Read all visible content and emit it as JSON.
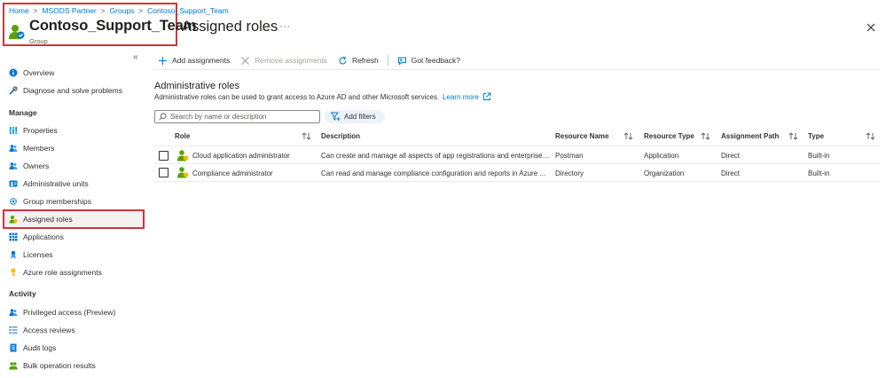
{
  "breadcrumb": [
    "Home",
    "MSODS Partner",
    "Groups",
    "Contoso_Support_Team"
  ],
  "header": {
    "group_name": "Contoso_Support_Team",
    "group_type": "Group",
    "page_title": "Assigned roles",
    "more_label": "···",
    "close_icon": "close-icon"
  },
  "sidebar": {
    "collapse_label": "«",
    "items": [
      {
        "label": "Overview",
        "icon": "info-icon",
        "color": "#0078d4"
      },
      {
        "label": "Diagnose and solve problems",
        "icon": "wrench-icon",
        "color": "#605e5c"
      }
    ],
    "manage_heading": "Manage",
    "manage_items": [
      {
        "label": "Properties",
        "icon": "properties-icon",
        "color": "#0078d4"
      },
      {
        "label": "Members",
        "icon": "members-icon",
        "color": "#0078d4"
      },
      {
        "label": "Owners",
        "icon": "owners-icon",
        "color": "#0078d4"
      },
      {
        "label": "Administrative units",
        "icon": "admin-units-icon",
        "color": "#0078d4"
      },
      {
        "label": "Group memberships",
        "icon": "gear-icon",
        "color": "#0078d4"
      },
      {
        "label": "Assigned roles",
        "icon": "assigned-roles-icon",
        "color": "#57a300",
        "selected": true
      },
      {
        "label": "Applications",
        "icon": "grid-icon",
        "color": "#0078d4"
      },
      {
        "label": "Licenses",
        "icon": "license-icon",
        "color": "#0078d4"
      },
      {
        "label": "Azure role assignments",
        "icon": "key-icon",
        "color": "#ffb900"
      }
    ],
    "activity_heading": "Activity",
    "activity_items": [
      {
        "label": "Privileged access (Preview)",
        "icon": "privileged-access-icon",
        "color": "#0078d4"
      },
      {
        "label": "Access reviews",
        "icon": "access-reviews-icon",
        "color": "#0078d4"
      },
      {
        "label": "Audit logs",
        "icon": "audit-logs-icon",
        "color": "#0078d4"
      },
      {
        "label": "Bulk operation results",
        "icon": "bulk-results-icon",
        "color": "#57a300"
      }
    ]
  },
  "toolbar": {
    "add_label": "Add assignments",
    "remove_label": "Remove assignments",
    "refresh_label": "Refresh",
    "feedback_label": "Got feedback?"
  },
  "section": {
    "title": "Administrative roles",
    "description": "Administrative roles can be used to grant access to Azure AD and other Microsoft services.",
    "learn_more": "Learn more"
  },
  "search": {
    "placeholder": "Search by name or description"
  },
  "filters": {
    "label": "Add filters"
  },
  "table": {
    "columns": [
      "Role",
      "Description",
      "Resource Name",
      "Resource Type",
      "Assignment Path",
      "Type"
    ],
    "rows": [
      {
        "role": "Cloud application administrator",
        "description": "Can create and manage all aspects of app registrations and enterprise ...",
        "resource_name": "Postman",
        "resource_type": "Application",
        "assignment_path": "Direct",
        "type": "Built-in"
      },
      {
        "role": "Compliance administrator",
        "description": "Can read and manage compliance configuration and reports in Azure ...",
        "resource_name": "Directory",
        "resource_type": "Organization",
        "assignment_path": "Direct",
        "type": "Built-in"
      }
    ]
  },
  "colors": {
    "accent": "#0078d4",
    "highlight_border": "#d13438",
    "role_icon_green": "#57a300"
  }
}
